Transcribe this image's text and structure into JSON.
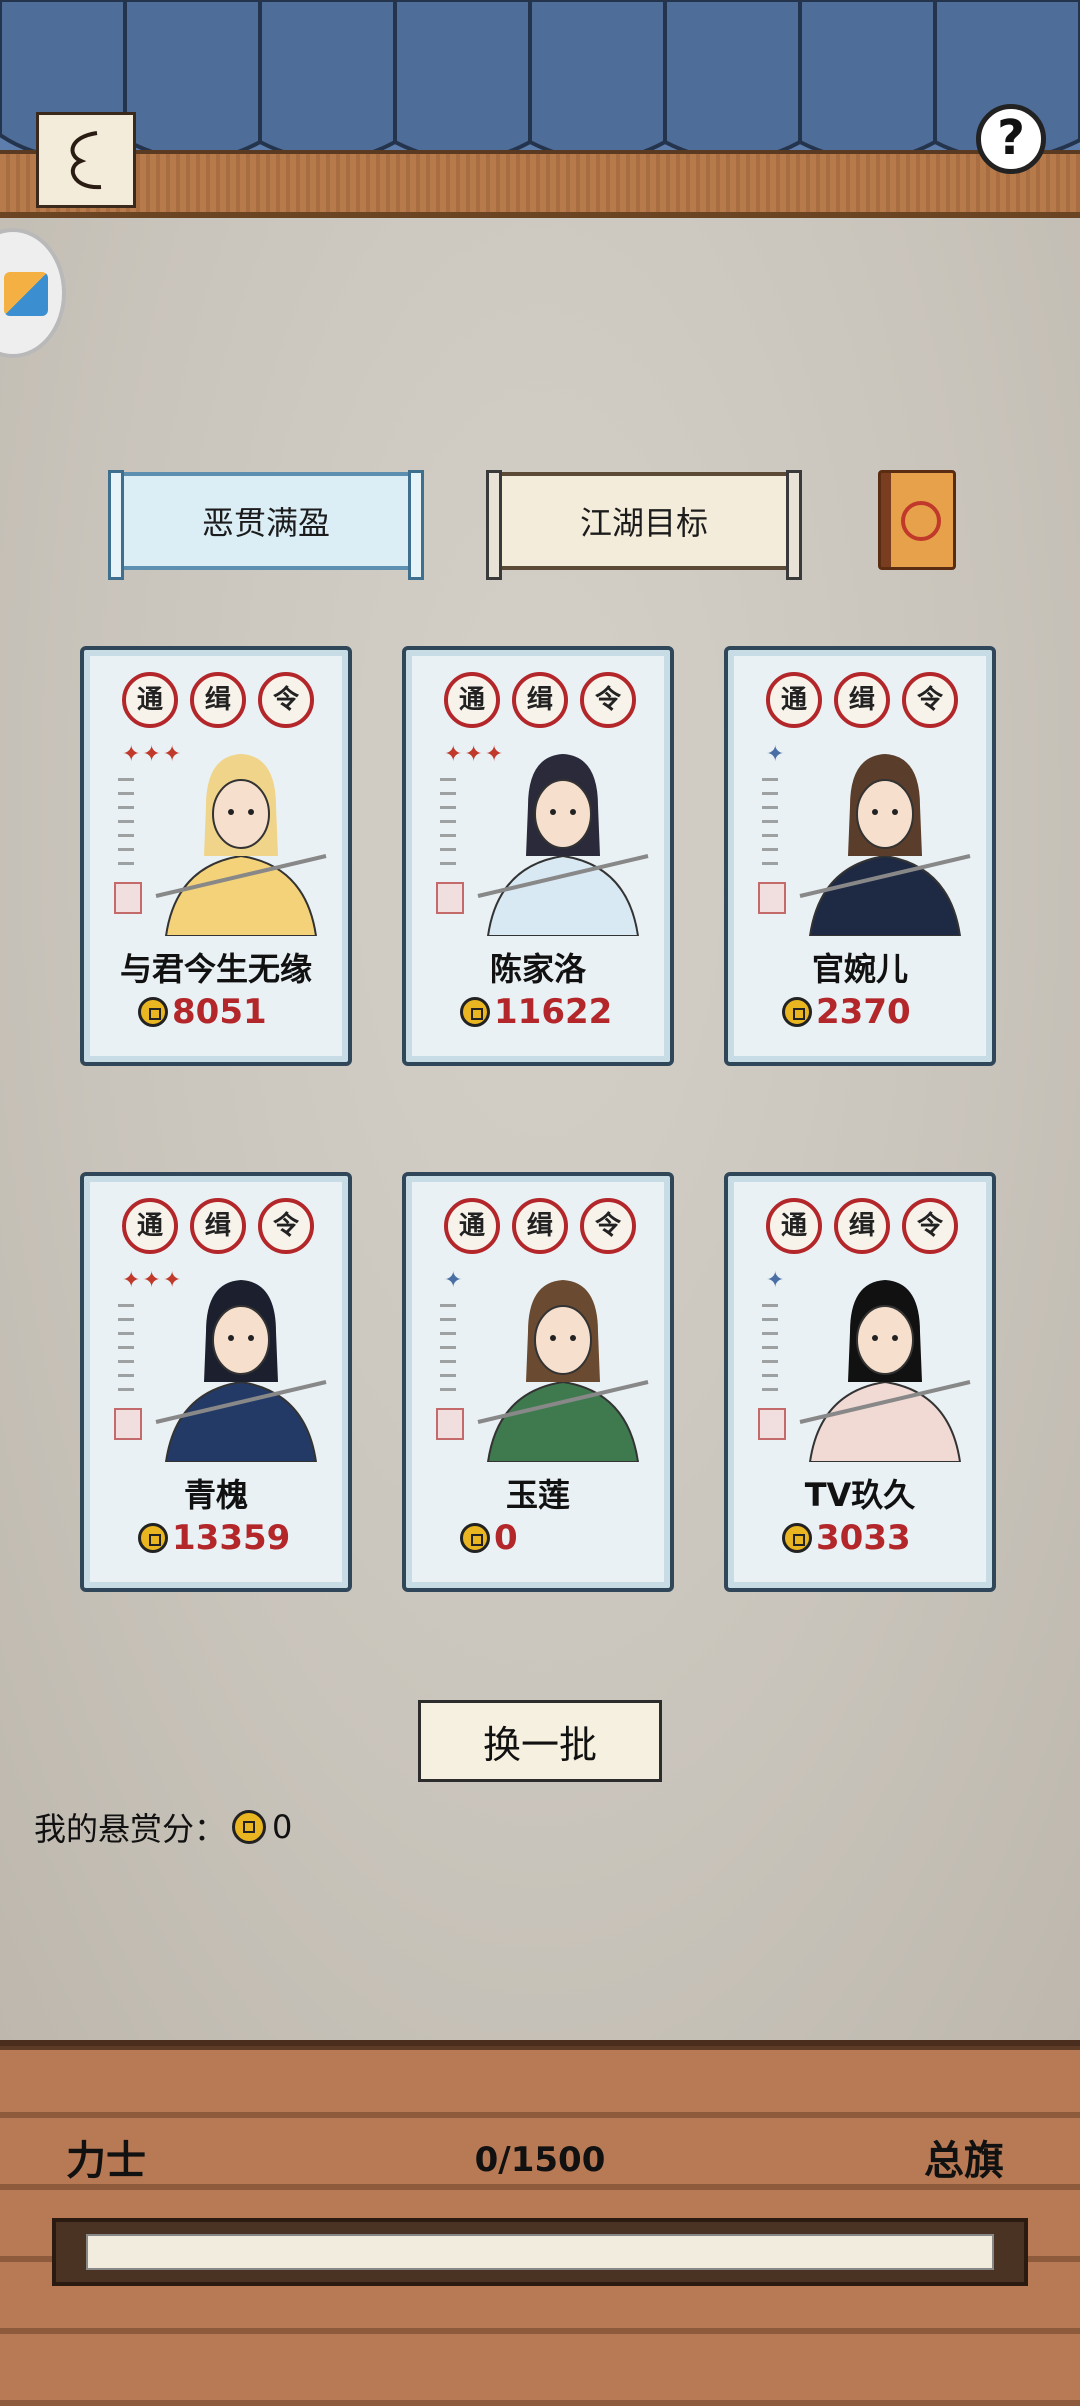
{
  "tabs": [
    {
      "label": "恶贯满盈"
    },
    {
      "label": "江湖目标"
    }
  ],
  "cards": [
    {
      "name": "与君今生无缘",
      "bounty": "8051",
      "stars": "✦✦✦",
      "star_color": "red"
    },
    {
      "name": "陈家洛",
      "bounty": "11622",
      "stars": "✦✦✦",
      "star_color": "red"
    },
    {
      "name": "官婉儿",
      "bounty": "2370",
      "stars": "✦",
      "star_color": "blue"
    },
    {
      "name": "青槐",
      "bounty": "13359",
      "stars": "✦✦✦",
      "star_color": "red"
    },
    {
      "name": "玉莲",
      "bounty": "0",
      "stars": "✦",
      "star_color": "blue"
    },
    {
      "name": "TV玖久",
      "bounty": "3033",
      "stars": "✦",
      "star_color": "blue"
    }
  ],
  "badges": [
    "通",
    "缉",
    "令"
  ],
  "refresh_label": "换一批",
  "my_bounty": {
    "label": "我的悬赏分：",
    "value": "0"
  },
  "rank": {
    "current": "力士",
    "next": "总旗",
    "progress_text": "0/1500",
    "progress_fraction": 0.0
  },
  "icons": [
    "back-icon",
    "help-icon",
    "book-icon",
    "coin-icon"
  ]
}
